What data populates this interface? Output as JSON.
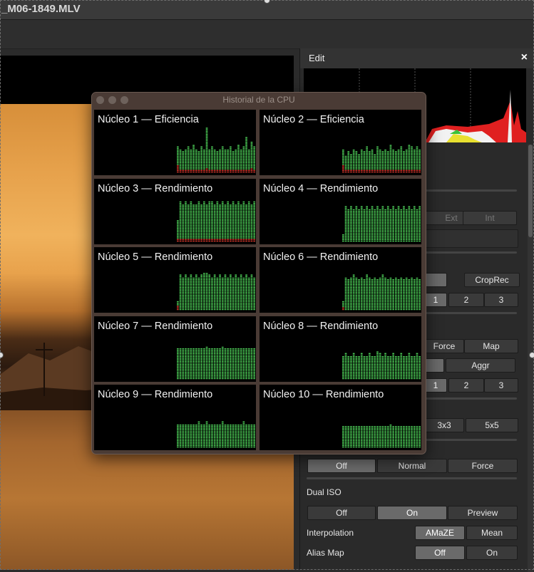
{
  "window": {
    "filename": "_M06-1849.MLV"
  },
  "cpu_history": {
    "title": "Historial de la CPU",
    "cores": [
      {
        "label": "Núcleo 1 — Eficiencia",
        "levels": [
          0.55,
          0.5,
          0.45,
          0.5,
          0.55,
          0.5,
          0.6,
          0.5,
          0.45,
          0.55,
          0.5,
          0.95,
          0.5,
          0.55,
          0.5,
          0.45,
          0.5,
          0.55,
          0.5,
          0.5,
          0.55,
          0.45,
          0.5,
          0.6,
          0.5,
          0.55,
          0.75,
          0.5,
          0.65,
          0.55
        ],
        "red": [
          0.15,
          0.05,
          0.05,
          0.05,
          0.08,
          0.05,
          0.05,
          0.05,
          0.05,
          0.05,
          0.05,
          0.1,
          0.05,
          0.05,
          0.05,
          0.05,
          0.05,
          0.05,
          0.05,
          0.05,
          0.05,
          0.05,
          0.05,
          0.05,
          0.05,
          0.05,
          0.05,
          0.05,
          0.1,
          0.05
        ]
      },
      {
        "label": "Núcleo 2 — Eficiencia",
        "levels": [
          0.5,
          0.35,
          0.45,
          0.4,
          0.5,
          0.45,
          0.4,
          0.5,
          0.45,
          0.55,
          0.45,
          0.5,
          0.4,
          0.55,
          0.5,
          0.45,
          0.5,
          0.45,
          0.6,
          0.5,
          0.45,
          0.5,
          0.55,
          0.45,
          0.5,
          0.6,
          0.55,
          0.5,
          0.55,
          0.5
        ],
        "red": [
          0.15,
          0.05,
          0.05,
          0.05,
          0.05,
          0.05,
          0.05,
          0.05,
          0.05,
          0.05,
          0.05,
          0.05,
          0.05,
          0.05,
          0.05,
          0.05,
          0.05,
          0.05,
          0.05,
          0.05,
          0.05,
          0.05,
          0.05,
          0.05,
          0.05,
          0.05,
          0.05,
          0.05,
          0.05,
          0.05
        ]
      },
      {
        "label": "Núcleo 3 — Rendimiento",
        "levels": [
          0.45,
          0.85,
          0.8,
          0.85,
          0.8,
          0.85,
          0.8,
          0.8,
          0.85,
          0.8,
          0.85,
          0.8,
          0.85,
          0.85,
          0.8,
          0.85,
          0.8,
          0.85,
          0.8,
          0.85,
          0.8,
          0.85,
          0.8,
          0.85,
          0.8,
          0.85,
          0.8,
          0.85,
          0.8,
          0.85
        ],
        "red": [
          0.08,
          0.08,
          0.08,
          0.08,
          0.08,
          0.08,
          0.08,
          0.08,
          0.08,
          0.08,
          0.08,
          0.08,
          0.08,
          0.08,
          0.08,
          0.08,
          0.08,
          0.08,
          0.08,
          0.08,
          0.08,
          0.08,
          0.08,
          0.08,
          0.08,
          0.08,
          0.08,
          0.08,
          0.08,
          0.08
        ]
      },
      {
        "label": "Núcleo 4 — Rendimiento",
        "levels": [
          0.15,
          0.75,
          0.7,
          0.75,
          0.7,
          0.75,
          0.7,
          0.75,
          0.7,
          0.75,
          0.7,
          0.75,
          0.7,
          0.75,
          0.7,
          0.75,
          0.7,
          0.75,
          0.7,
          0.75,
          0.7,
          0.75,
          0.7,
          0.75,
          0.7,
          0.75,
          0.7,
          0.75,
          0.7,
          0.75
        ],
        "red": [
          0,
          0,
          0,
          0,
          0,
          0,
          0,
          0,
          0,
          0,
          0,
          0,
          0,
          0,
          0,
          0,
          0,
          0,
          0,
          0,
          0,
          0,
          0,
          0,
          0,
          0,
          0,
          0,
          0,
          0
        ]
      },
      {
        "label": "Núcleo 5 — Rendimiento",
        "levels": [
          0.2,
          0.75,
          0.7,
          0.75,
          0.7,
          0.75,
          0.7,
          0.75,
          0.7,
          0.75,
          0.8,
          0.8,
          0.75,
          0.7,
          0.75,
          0.7,
          0.75,
          0.7,
          0.75,
          0.7,
          0.75,
          0.7,
          0.75,
          0.7,
          0.75,
          0.7,
          0.75,
          0.7,
          0.75,
          0.7
        ],
        "red": [
          0.1,
          0,
          0,
          0,
          0,
          0,
          0,
          0,
          0,
          0,
          0,
          0,
          0,
          0,
          0,
          0,
          0,
          0,
          0,
          0,
          0,
          0,
          0,
          0,
          0,
          0,
          0,
          0,
          0,
          0
        ]
      },
      {
        "label": "Núcleo 6 — Rendimiento",
        "levels": [
          0.2,
          0.7,
          0.65,
          0.7,
          0.75,
          0.7,
          0.65,
          0.7,
          0.65,
          0.75,
          0.7,
          0.65,
          0.7,
          0.65,
          0.7,
          0.75,
          0.7,
          0.65,
          0.7,
          0.65,
          0.7,
          0.65,
          0.7,
          0.65,
          0.7,
          0.65,
          0.7,
          0.65,
          0.7,
          0.65
        ],
        "red": [
          0.08,
          0,
          0,
          0,
          0,
          0,
          0,
          0,
          0,
          0,
          0,
          0,
          0,
          0,
          0,
          0,
          0,
          0,
          0,
          0,
          0,
          0,
          0,
          0,
          0,
          0,
          0,
          0,
          0,
          0
        ]
      },
      {
        "label": "Núcleo 7 — Rendimiento",
        "levels": [
          0.65,
          0.65,
          0.65,
          0.65,
          0.65,
          0.65,
          0.65,
          0.65,
          0.65,
          0.65,
          0.65,
          0.7,
          0.65,
          0.65,
          0.65,
          0.65,
          0.65,
          0.7,
          0.65,
          0.65,
          0.65,
          0.65,
          0.65,
          0.65,
          0.65,
          0.65,
          0.65,
          0.65,
          0.65,
          0.65
        ],
        "red": [
          0,
          0,
          0,
          0,
          0,
          0,
          0,
          0,
          0,
          0,
          0,
          0,
          0,
          0,
          0,
          0,
          0,
          0,
          0,
          0,
          0,
          0,
          0,
          0,
          0,
          0,
          0,
          0,
          0,
          0
        ]
      },
      {
        "label": "Núcleo 8 — Rendimiento",
        "levels": [
          0.5,
          0.55,
          0.5,
          0.5,
          0.55,
          0.5,
          0.5,
          0.55,
          0.5,
          0.5,
          0.55,
          0.5,
          0.5,
          0.6,
          0.55,
          0.5,
          0.55,
          0.5,
          0.5,
          0.55,
          0.5,
          0.5,
          0.55,
          0.5,
          0.5,
          0.55,
          0.5,
          0.5,
          0.55,
          0.5
        ],
        "red": [
          0,
          0,
          0,
          0,
          0,
          0,
          0,
          0,
          0,
          0,
          0,
          0,
          0,
          0,
          0,
          0,
          0,
          0,
          0,
          0,
          0,
          0,
          0,
          0,
          0,
          0,
          0,
          0,
          0,
          0
        ]
      },
      {
        "label": "Núcleo 9 — Rendimiento",
        "levels": [
          0.5,
          0.5,
          0.5,
          0.5,
          0.5,
          0.5,
          0.5,
          0.5,
          0.55,
          0.5,
          0.5,
          0.55,
          0.5,
          0.5,
          0.5,
          0.5,
          0.5,
          0.55,
          0.5,
          0.5,
          0.5,
          0.5,
          0.5,
          0.5,
          0.5,
          0.55,
          0.5,
          0.5,
          0.5,
          0.5
        ],
        "red": [
          0,
          0,
          0,
          0,
          0,
          0,
          0,
          0,
          0,
          0,
          0,
          0,
          0,
          0,
          0,
          0,
          0,
          0,
          0,
          0,
          0,
          0,
          0,
          0,
          0,
          0,
          0,
          0,
          0,
          0
        ]
      },
      {
        "label": "Núcleo 10 — Rendimiento",
        "levels": [
          0.45,
          0.45,
          0.45,
          0.45,
          0.45,
          0.45,
          0.45,
          0.45,
          0.45,
          0.45,
          0.45,
          0.45,
          0.45,
          0.45,
          0.45,
          0.45,
          0.45,
          0.45,
          0.5,
          0.45,
          0.45,
          0.45,
          0.45,
          0.45,
          0.45,
          0.45,
          0.45,
          0.45,
          0.45,
          0.45
        ],
        "red": [
          0,
          0,
          0,
          0,
          0,
          0,
          0,
          0,
          0,
          0,
          0,
          0,
          0,
          0,
          0,
          0,
          0,
          0,
          0,
          0,
          0,
          0,
          0,
          0,
          0,
          0,
          0,
          0,
          0,
          0
        ]
      }
    ]
  },
  "edit_panel": {
    "title": "Edit",
    "close_symbol": "×",
    "buttons": {
      "ext": "Ext",
      "int": "Int",
      "croprec": "CropRec",
      "b1a": "1",
      "b2a": "2",
      "b3a": "3",
      "force_a": "Force",
      "map": "Map",
      "aggr": "Aggr",
      "b1b": "1",
      "b2b": "2",
      "b3b": "3",
      "x3": "3x3",
      "x5": "5x5",
      "off_a": "Off",
      "normal": "Normal",
      "force_b": "Force"
    },
    "dual_iso": {
      "label": "Dual ISO",
      "off": "Off",
      "on": "On",
      "preview": "Preview"
    },
    "interpolation": {
      "label": "Interpolation",
      "amaze": "AMaZE",
      "mean": "Mean"
    },
    "alias_map": {
      "label": "Alias Map",
      "off": "Off",
      "on": "On"
    }
  },
  "colors": {
    "cpu_green": "#4fd35a",
    "cpu_red": "#d5372b",
    "active_button": "#6a6a6a"
  }
}
